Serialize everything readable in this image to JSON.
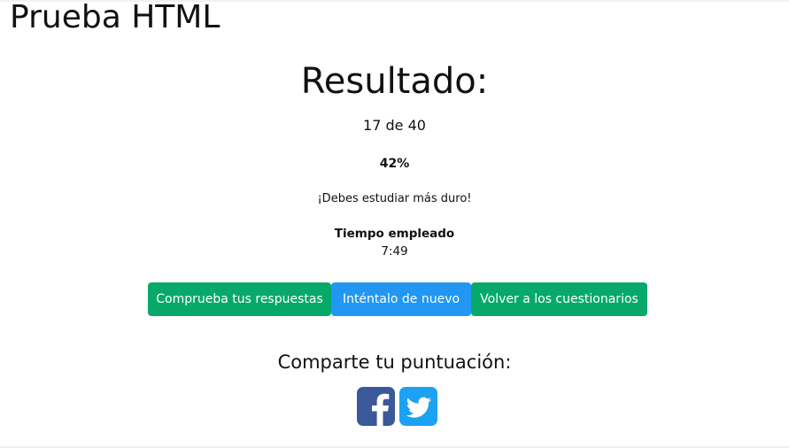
{
  "page": {
    "title": "Prueba HTML"
  },
  "result": {
    "heading": "Resultado:",
    "score_text": "17 de 40",
    "percent_text": "42%",
    "feedback": "¡Debes estudiar más duro!",
    "time_label": "Tiempo empleado",
    "time_value": "7:49"
  },
  "progress": {
    "correct": 17,
    "total": 40,
    "percent": 42
  },
  "actions": {
    "check_answers": "Comprueba tus respuestas",
    "try_again": "Inténtalo de nuevo",
    "back_to_quizzes": "Volver a los cuestionarios"
  },
  "share": {
    "heading": "Comparte tu puntuación:",
    "networks": [
      {
        "name": "facebook-icon",
        "color": "#3b5998"
      },
      {
        "name": "twitter-icon",
        "color": "#1da1f2"
      }
    ]
  },
  "colors": {
    "green": "#06a96a",
    "blue": "#2196f3"
  }
}
